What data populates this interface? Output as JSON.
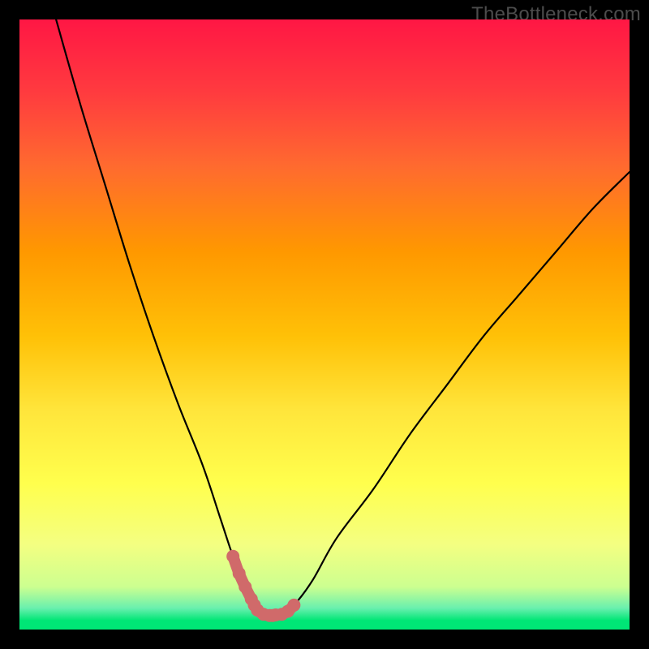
{
  "watermark": {
    "text": "TheBottleneck.com"
  },
  "colors": {
    "frame": "#000000",
    "gradient": [
      "#ff1744",
      "#ff3b3f",
      "#ff6a2f",
      "#ff9800",
      "#ffc107",
      "#ffe53b",
      "#ffff4d",
      "#f4ff81",
      "#ccff90",
      "#69f0ae",
      "#00e676"
    ],
    "curve": "#000000",
    "highlight": "#d06a6a"
  },
  "chart_data": {
    "type": "line",
    "title": "",
    "xlabel": "",
    "ylabel": "",
    "xlim": [
      0,
      100
    ],
    "ylim": [
      0,
      100
    ],
    "series": [
      {
        "name": "bottleneck-curve",
        "x": [
          6,
          10,
          14,
          18,
          22,
          26,
          30,
          33,
          35,
          37,
          38.5,
          40,
          41.5,
          43,
          45,
          48,
          52,
          58,
          64,
          70,
          76,
          82,
          88,
          94,
          100
        ],
        "values": [
          100,
          86,
          73,
          60,
          48,
          37,
          27,
          18,
          12,
          7,
          4,
          2.5,
          2.3,
          2.5,
          4,
          8,
          15,
          23,
          32,
          40,
          48,
          55,
          62,
          69,
          75
        ]
      },
      {
        "name": "highlight-segment",
        "x": [
          35,
          36,
          37,
          38,
          38.5,
          39,
          40,
          41,
          41.5,
          42,
          43,
          44,
          45
        ],
        "values": [
          12,
          9.2,
          7,
          5,
          4,
          3.2,
          2.5,
          2.3,
          2.3,
          2.4,
          2.5,
          3,
          4
        ]
      }
    ],
    "legend": []
  }
}
